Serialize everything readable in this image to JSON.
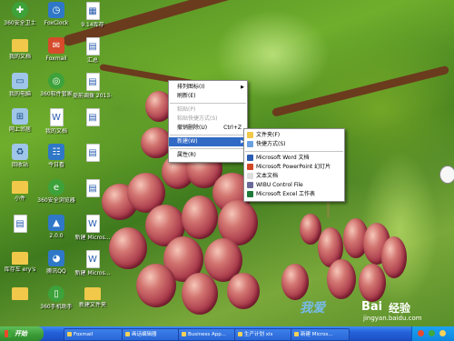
{
  "desktop_icons": [
    {
      "label": "360安全卫士",
      "icon": "shield-icon",
      "kind": "green",
      "glyph": "✚"
    },
    {
      "label": "FoxClock",
      "icon": "clock-icon",
      "kind": "app",
      "glyph": "◷"
    },
    {
      "label": "9.14库存",
      "icon": "excel-doc-icon",
      "kind": "doc",
      "glyph": "▦"
    },
    {
      "label": "我的文档",
      "icon": "documents-folder-icon",
      "kind": "folder",
      "glyph": ""
    },
    {
      "label": "Foxmail",
      "icon": "foxmail-icon",
      "kind": "red",
      "glyph": "✉"
    },
    {
      "label": "汇总",
      "icon": "doc-icon",
      "kind": "doc",
      "glyph": "▤"
    },
    {
      "label": "我的电脑",
      "icon": "computer-icon",
      "kind": "pc",
      "glyph": "▭"
    },
    {
      "label": "360软件管家",
      "icon": "app-store-icon",
      "kind": "green",
      "glyph": "◎"
    },
    {
      "label": "提前调拨 2013-2-21",
      "icon": "doc-icon",
      "kind": "doc",
      "glyph": "▤"
    },
    {
      "label": "网上邻居",
      "icon": "network-icon",
      "kind": "pc",
      "glyph": "⊞"
    },
    {
      "label": "我的文档",
      "icon": "word-doc-icon",
      "kind": "doc",
      "glyph": "W"
    },
    {
      "label": "",
      "icon": "doc-icon",
      "kind": "doc",
      "glyph": "▤"
    },
    {
      "label": "回收站",
      "icon": "recycle-bin-icon",
      "kind": "pc",
      "glyph": "♻"
    },
    {
      "label": "今日看",
      "icon": "calendar-icon",
      "kind": "app",
      "glyph": "☷"
    },
    {
      "label": "",
      "icon": "doc-icon",
      "kind": "doc",
      "glyph": "▤"
    },
    {
      "label": "小件",
      "icon": "folder-icon",
      "kind": "folder",
      "glyph": ""
    },
    {
      "label": "360安全浏览器",
      "icon": "browser-icon",
      "kind": "green",
      "glyph": "e"
    },
    {
      "label": "",
      "icon": "doc-icon",
      "kind": "doc",
      "glyph": "▤"
    },
    {
      "label": "",
      "icon": "doc-icon",
      "kind": "doc",
      "glyph": "▤"
    },
    {
      "label": "2.0.0",
      "icon": "app-icon",
      "kind": "app",
      "glyph": "▲"
    },
    {
      "label": "新建 Micros...",
      "icon": "word-doc-icon",
      "kind": "doc",
      "glyph": "W"
    },
    {
      "label": "库存车 ery's",
      "icon": "folder-icon",
      "kind": "folder",
      "glyph": ""
    },
    {
      "label": "腾讯QQ",
      "icon": "qq-icon",
      "kind": "app",
      "glyph": "◕"
    },
    {
      "label": "新建 Micros...",
      "icon": "word-doc-icon",
      "kind": "doc",
      "glyph": "W"
    },
    {
      "label": "",
      "icon": "folder-icon",
      "kind": "folder",
      "glyph": ""
    },
    {
      "label": "360手机助手",
      "icon": "phone-assistant-icon",
      "kind": "green",
      "glyph": "▯"
    },
    {
      "label": "新建文件夹",
      "icon": "folder-icon",
      "kind": "folder",
      "glyph": ""
    }
  ],
  "context_menu": {
    "items": [
      {
        "label": "排列图标(I)",
        "state": "normal",
        "submenu": true
      },
      {
        "label": "刷新(E)",
        "state": "normal"
      },
      {
        "sep": true
      },
      {
        "label": "粘贴(P)",
        "state": "disabled"
      },
      {
        "label": "粘贴快捷方式(S)",
        "state": "disabled"
      },
      {
        "label": "撤销删除(U)",
        "shortcut": "Ctrl+Z",
        "state": "normal"
      },
      {
        "sep": true
      },
      {
        "label": "新建(W)",
        "state": "highlighted",
        "submenu": true
      },
      {
        "sep": true
      },
      {
        "label": "属性(R)",
        "state": "normal"
      }
    ]
  },
  "new_submenu": {
    "items": [
      {
        "label": "文件夹(F)",
        "icon": "folder-icon",
        "color": "#f1c84a"
      },
      {
        "label": "快捷方式(S)",
        "icon": "shortcut-icon",
        "color": "#6aa0e0"
      },
      {
        "sep": true
      },
      {
        "label": "Microsoft Word 文档",
        "icon": "word-icon",
        "color": "#2a5db0"
      },
      {
        "label": "Microsoft PowerPoint 幻灯片",
        "icon": "powerpoint-icon",
        "color": "#d24726"
      },
      {
        "label": "文本文档",
        "icon": "text-doc-icon",
        "color": "#dcdcdc"
      },
      {
        "label": "WIBU Control File",
        "icon": "wibu-icon",
        "color": "#6a6a9a"
      },
      {
        "label": "Microsoft Excel 工作表",
        "icon": "excel-icon",
        "color": "#1d7a3a"
      }
    ]
  },
  "taskbar": {
    "start_label": "开始",
    "buttons": [
      {
        "label": "Foxmail"
      },
      {
        "label": "画话编辑器"
      },
      {
        "label": "Business App..."
      },
      {
        "label": "生产计划 xls"
      },
      {
        "label": "新建 Micros..."
      }
    ]
  },
  "watermark": {
    "brand": "Bai",
    "brand2": "经验",
    "url": "jingyan.baidu.com",
    "slogan": "我爱"
  }
}
